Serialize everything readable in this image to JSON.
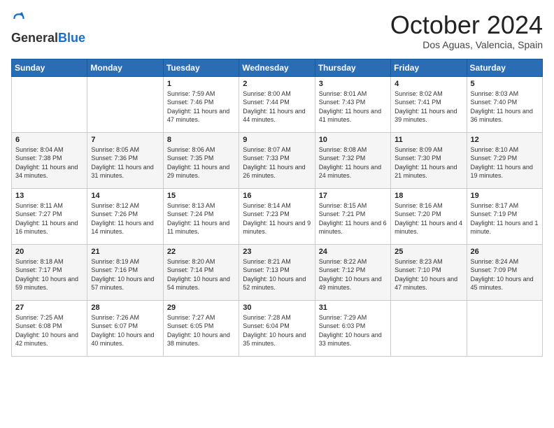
{
  "header": {
    "logo_general": "General",
    "logo_blue": "Blue",
    "month_title": "October 2024",
    "subtitle": "Dos Aguas, Valencia, Spain"
  },
  "weekdays": [
    "Sunday",
    "Monday",
    "Tuesday",
    "Wednesday",
    "Thursday",
    "Friday",
    "Saturday"
  ],
  "weeks": [
    [
      {
        "day": "",
        "info": ""
      },
      {
        "day": "",
        "info": ""
      },
      {
        "day": "1",
        "info": "Sunrise: 7:59 AM\nSunset: 7:46 PM\nDaylight: 11 hours and 47 minutes."
      },
      {
        "day": "2",
        "info": "Sunrise: 8:00 AM\nSunset: 7:44 PM\nDaylight: 11 hours and 44 minutes."
      },
      {
        "day": "3",
        "info": "Sunrise: 8:01 AM\nSunset: 7:43 PM\nDaylight: 11 hours and 41 minutes."
      },
      {
        "day": "4",
        "info": "Sunrise: 8:02 AM\nSunset: 7:41 PM\nDaylight: 11 hours and 39 minutes."
      },
      {
        "day": "5",
        "info": "Sunrise: 8:03 AM\nSunset: 7:40 PM\nDaylight: 11 hours and 36 minutes."
      }
    ],
    [
      {
        "day": "6",
        "info": "Sunrise: 8:04 AM\nSunset: 7:38 PM\nDaylight: 11 hours and 34 minutes."
      },
      {
        "day": "7",
        "info": "Sunrise: 8:05 AM\nSunset: 7:36 PM\nDaylight: 11 hours and 31 minutes."
      },
      {
        "day": "8",
        "info": "Sunrise: 8:06 AM\nSunset: 7:35 PM\nDaylight: 11 hours and 29 minutes."
      },
      {
        "day": "9",
        "info": "Sunrise: 8:07 AM\nSunset: 7:33 PM\nDaylight: 11 hours and 26 minutes."
      },
      {
        "day": "10",
        "info": "Sunrise: 8:08 AM\nSunset: 7:32 PM\nDaylight: 11 hours and 24 minutes."
      },
      {
        "day": "11",
        "info": "Sunrise: 8:09 AM\nSunset: 7:30 PM\nDaylight: 11 hours and 21 minutes."
      },
      {
        "day": "12",
        "info": "Sunrise: 8:10 AM\nSunset: 7:29 PM\nDaylight: 11 hours and 19 minutes."
      }
    ],
    [
      {
        "day": "13",
        "info": "Sunrise: 8:11 AM\nSunset: 7:27 PM\nDaylight: 11 hours and 16 minutes."
      },
      {
        "day": "14",
        "info": "Sunrise: 8:12 AM\nSunset: 7:26 PM\nDaylight: 11 hours and 14 minutes."
      },
      {
        "day": "15",
        "info": "Sunrise: 8:13 AM\nSunset: 7:24 PM\nDaylight: 11 hours and 11 minutes."
      },
      {
        "day": "16",
        "info": "Sunrise: 8:14 AM\nSunset: 7:23 PM\nDaylight: 11 hours and 9 minutes."
      },
      {
        "day": "17",
        "info": "Sunrise: 8:15 AM\nSunset: 7:21 PM\nDaylight: 11 hours and 6 minutes."
      },
      {
        "day": "18",
        "info": "Sunrise: 8:16 AM\nSunset: 7:20 PM\nDaylight: 11 hours and 4 minutes."
      },
      {
        "day": "19",
        "info": "Sunrise: 8:17 AM\nSunset: 7:19 PM\nDaylight: 11 hours and 1 minute."
      }
    ],
    [
      {
        "day": "20",
        "info": "Sunrise: 8:18 AM\nSunset: 7:17 PM\nDaylight: 10 hours and 59 minutes."
      },
      {
        "day": "21",
        "info": "Sunrise: 8:19 AM\nSunset: 7:16 PM\nDaylight: 10 hours and 57 minutes."
      },
      {
        "day": "22",
        "info": "Sunrise: 8:20 AM\nSunset: 7:14 PM\nDaylight: 10 hours and 54 minutes."
      },
      {
        "day": "23",
        "info": "Sunrise: 8:21 AM\nSunset: 7:13 PM\nDaylight: 10 hours and 52 minutes."
      },
      {
        "day": "24",
        "info": "Sunrise: 8:22 AM\nSunset: 7:12 PM\nDaylight: 10 hours and 49 minutes."
      },
      {
        "day": "25",
        "info": "Sunrise: 8:23 AM\nSunset: 7:10 PM\nDaylight: 10 hours and 47 minutes."
      },
      {
        "day": "26",
        "info": "Sunrise: 8:24 AM\nSunset: 7:09 PM\nDaylight: 10 hours and 45 minutes."
      }
    ],
    [
      {
        "day": "27",
        "info": "Sunrise: 7:25 AM\nSunset: 6:08 PM\nDaylight: 10 hours and 42 minutes."
      },
      {
        "day": "28",
        "info": "Sunrise: 7:26 AM\nSunset: 6:07 PM\nDaylight: 10 hours and 40 minutes."
      },
      {
        "day": "29",
        "info": "Sunrise: 7:27 AM\nSunset: 6:05 PM\nDaylight: 10 hours and 38 minutes."
      },
      {
        "day": "30",
        "info": "Sunrise: 7:28 AM\nSunset: 6:04 PM\nDaylight: 10 hours and 35 minutes."
      },
      {
        "day": "31",
        "info": "Sunrise: 7:29 AM\nSunset: 6:03 PM\nDaylight: 10 hours and 33 minutes."
      },
      {
        "day": "",
        "info": ""
      },
      {
        "day": "",
        "info": ""
      }
    ]
  ]
}
